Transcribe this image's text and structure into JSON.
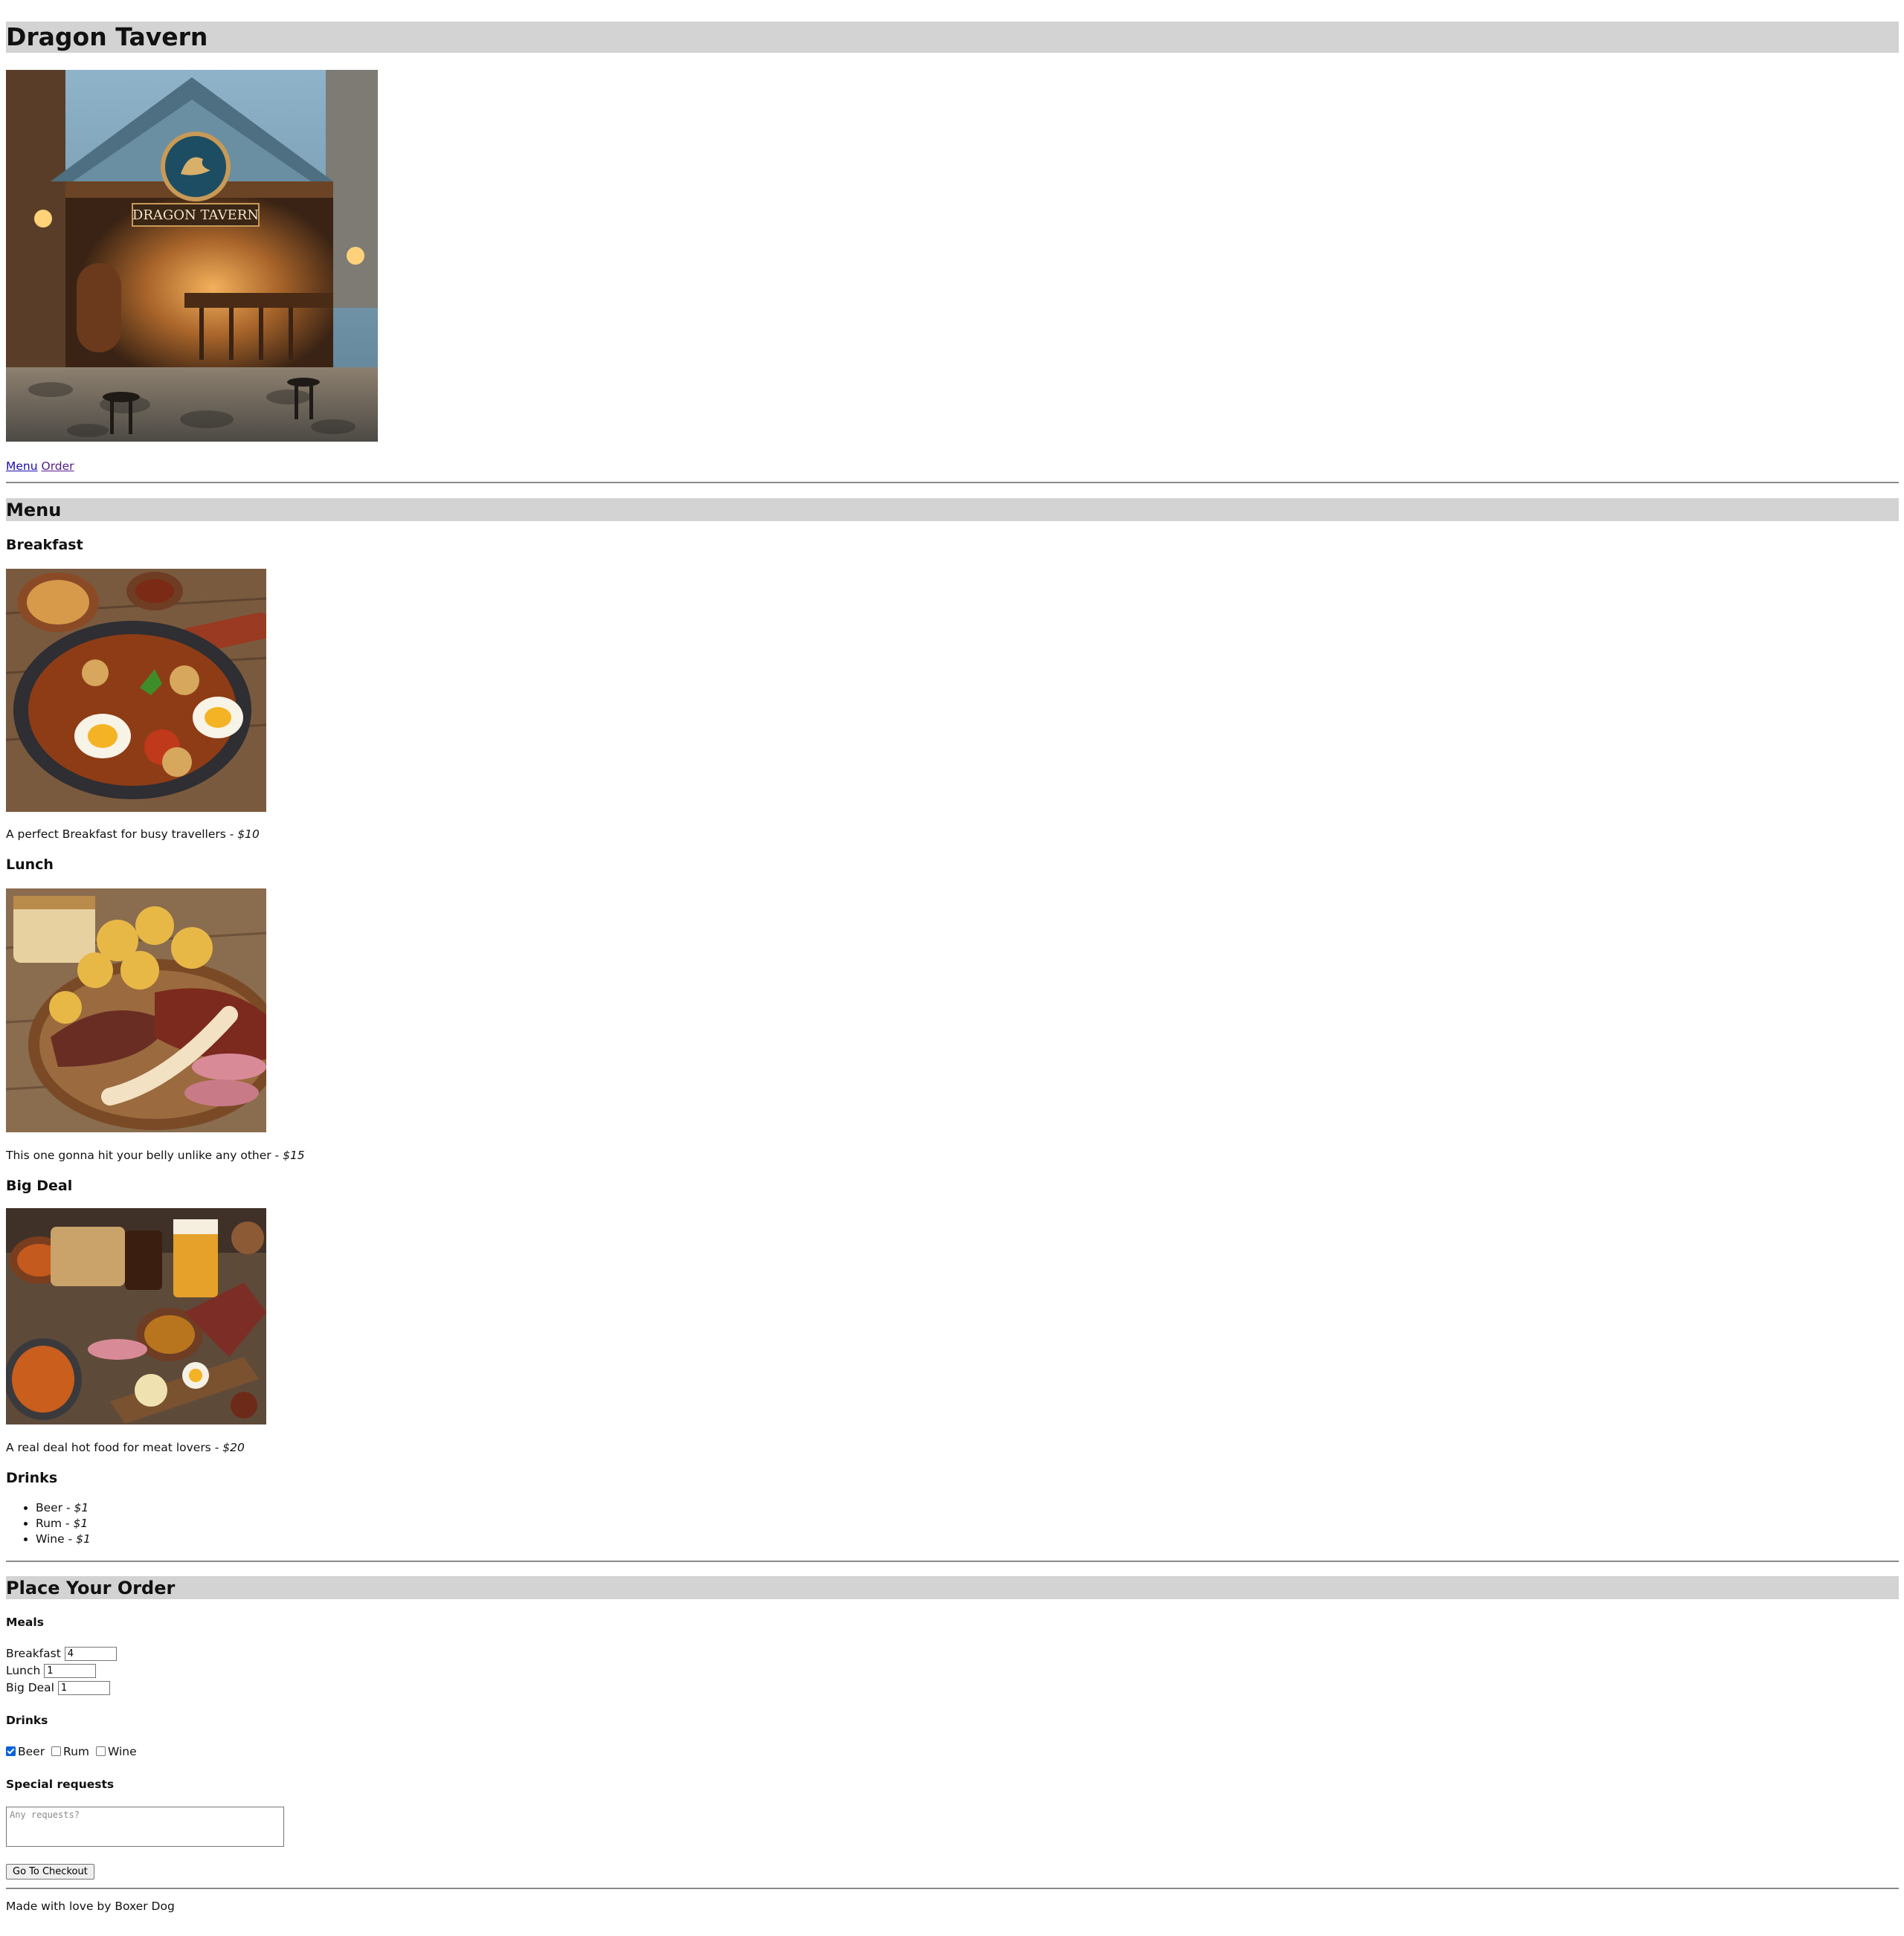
{
  "header": {
    "title": "Dragon Tavern"
  },
  "hero": {
    "sign_text": "DRAGON TAVERN"
  },
  "nav": {
    "links": [
      "Menu",
      "Order"
    ]
  },
  "menu": {
    "title": "Menu",
    "items": [
      {
        "name": "Breakfast",
        "description": "A perfect Breakfast for busy travellers - ",
        "price": "$10"
      },
      {
        "name": "Lunch",
        "description": "This one gonna hit your belly unlike any other - ",
        "price": "$15"
      },
      {
        "name": "Big Deal",
        "description": "A real deal hot food for meat lovers - ",
        "price": "$20"
      }
    ],
    "drinks_title": "Drinks",
    "drinks": [
      {
        "name": "Beer - ",
        "price": "$1"
      },
      {
        "name": "Rum - ",
        "price": "$1"
      },
      {
        "name": "Wine - ",
        "price": "$1"
      }
    ]
  },
  "order": {
    "title": "Place Your Order",
    "meals_title": "Meals",
    "meals": [
      {
        "label": "Breakfast",
        "value": "4"
      },
      {
        "label": "Lunch",
        "value": "1"
      },
      {
        "label": "Big Deal",
        "value": "1"
      }
    ],
    "drinks_title": "Drinks",
    "drinks": [
      {
        "label": "Beer",
        "checked": true
      },
      {
        "label": "Rum",
        "checked": false
      },
      {
        "label": "Wine",
        "checked": false
      }
    ],
    "requests_title": "Special requests",
    "requests_placeholder": "Any requests?",
    "checkout_label": "Go To Checkout"
  },
  "footer": {
    "text": "Made with love by Boxer Dog"
  },
  "colors": {
    "section_bar": "#d3d3d3",
    "link": "#1a0dab",
    "link_visited": "#551a8b",
    "checkbox_on": "#0b61d6"
  }
}
